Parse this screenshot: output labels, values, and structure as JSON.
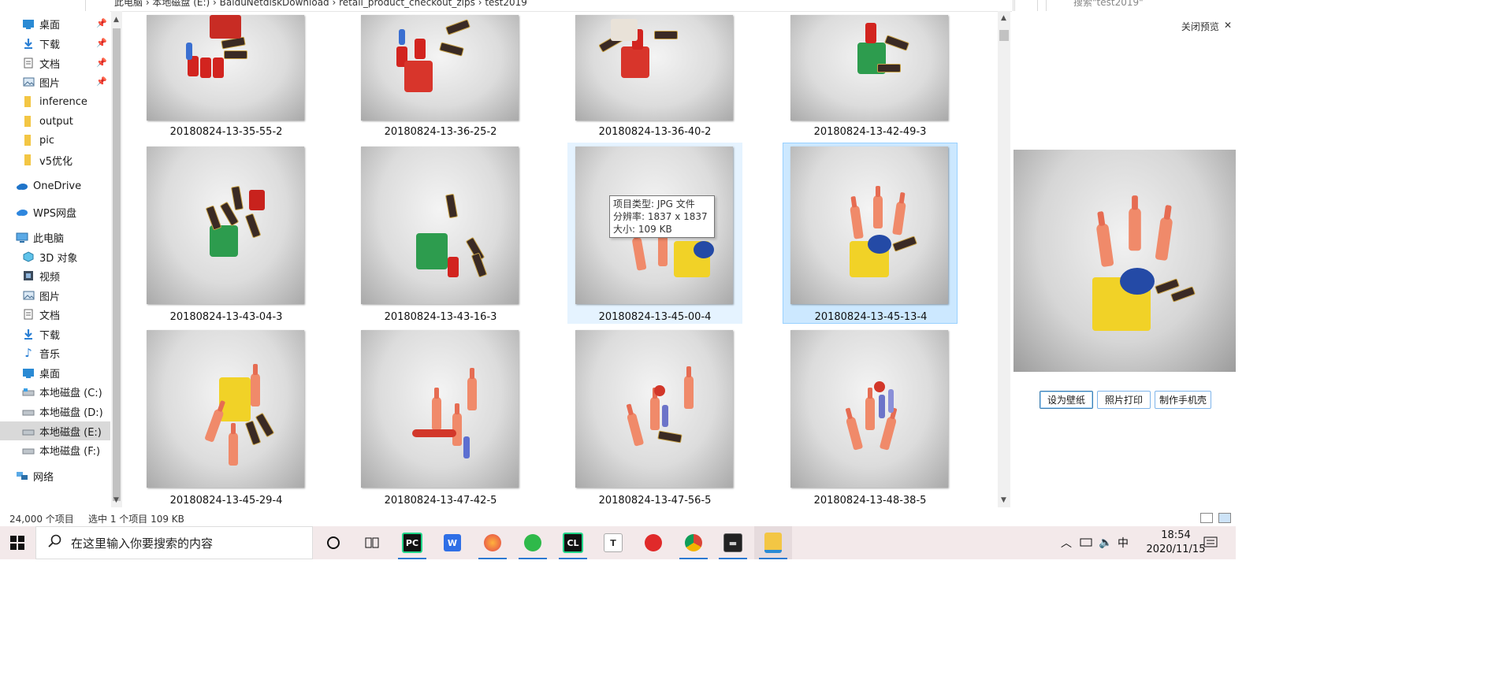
{
  "address_bar": {
    "path": "此电脑 › 本地磁盘 (E:) › BaiduNetdiskDownload › retail_product_checkout_zips › test2019",
    "search_placeholder": "搜索\"test2019\""
  },
  "sidebar": {
    "items": [
      {
        "label": "桌面",
        "icon": "desktop-icon",
        "pinned": true
      },
      {
        "label": "下载",
        "icon": "download-icon",
        "pinned": true
      },
      {
        "label": "文档",
        "icon": "document-icon",
        "pinned": true
      },
      {
        "label": "图片",
        "icon": "picture-icon",
        "pinned": true
      },
      {
        "label": "inference",
        "icon": "folder-icon"
      },
      {
        "label": "output",
        "icon": "folder-icon"
      },
      {
        "label": "pic",
        "icon": "folder-icon"
      },
      {
        "label": "v5优化",
        "icon": "folder-icon"
      },
      {
        "label": "OneDrive",
        "icon": "cloud-icon"
      },
      {
        "label": "WPS网盘",
        "icon": "cloud-icon"
      },
      {
        "label": "此电脑",
        "icon": "computer-icon"
      },
      {
        "label": "3D 对象",
        "icon": "3d-objects-icon"
      },
      {
        "label": "视频",
        "icon": "video-icon"
      },
      {
        "label": "图片",
        "icon": "picture-icon"
      },
      {
        "label": "文档",
        "icon": "document-icon"
      },
      {
        "label": "下载",
        "icon": "download-icon"
      },
      {
        "label": "音乐",
        "icon": "music-icon"
      },
      {
        "label": "桌面",
        "icon": "desktop-icon"
      },
      {
        "label": "本地磁盘 (C:)",
        "icon": "drive-icon"
      },
      {
        "label": "本地磁盘 (D:)",
        "icon": "drive-icon"
      },
      {
        "label": "本地磁盘 (E:)",
        "icon": "drive-icon",
        "selected": true
      },
      {
        "label": "本地磁盘 (F:)",
        "icon": "drive-icon"
      },
      {
        "label": "网络",
        "icon": "network-icon"
      }
    ]
  },
  "files": [
    "20180824-13-35-55-2",
    "20180824-13-36-25-2",
    "20180824-13-36-40-2",
    "20180824-13-42-49-3",
    "20180824-13-43-04-3",
    "20180824-13-43-16-3",
    "20180824-13-45-00-4",
    "20180824-13-45-13-4",
    "20180824-13-45-29-4",
    "20180824-13-47-42-5",
    "20180824-13-47-56-5",
    "20180824-13-48-38-5"
  ],
  "tooltip": {
    "type": "项目类型: JPG 文件",
    "resolution": "分辨率: 1837 x 1837",
    "size": "大小: 109 KB"
  },
  "preview": {
    "close_label": "关闭预览",
    "buttons": [
      "设为壁纸",
      "照片打印",
      "制作手机壳"
    ]
  },
  "status": {
    "count": "24,000 个项目",
    "selection": "选中 1 个项目  109 KB"
  },
  "taskbar": {
    "search_placeholder": "在这里输入你要搜索的内容",
    "apps": [
      "cortana-icon",
      "task-view-icon",
      "pycharm-icon",
      "wps-icon",
      "firefox-icon",
      "wechat-icon",
      "clion-icon",
      "typora-icon",
      "netease-music-icon",
      "chrome-icon",
      "terminal-icon",
      "file-explorer-icon"
    ],
    "ime": "中",
    "time": "18:54",
    "date": "2020/11/15"
  }
}
